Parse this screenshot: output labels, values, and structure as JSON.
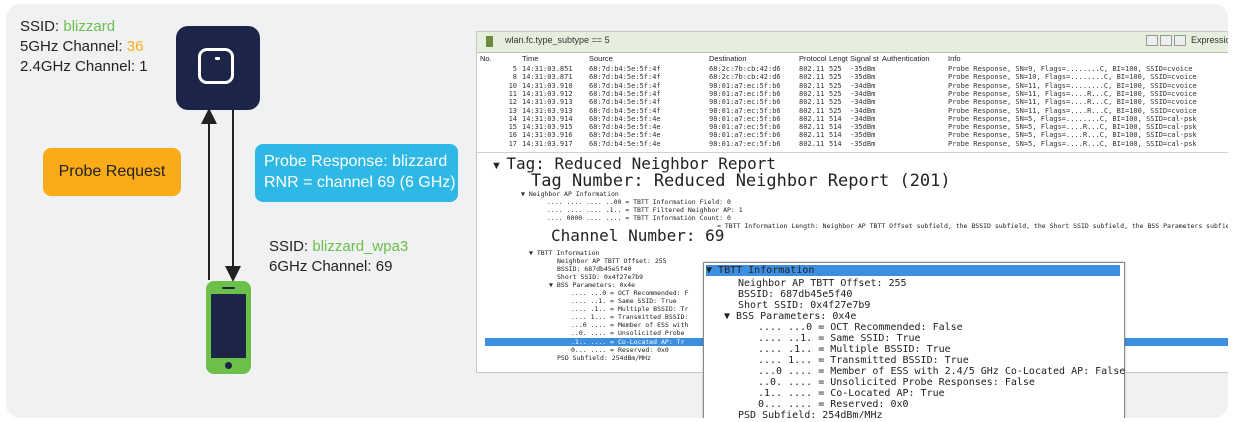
{
  "ap": {
    "ssid_label": "SSID: ",
    "ssid": "blizzard",
    "ch5_label": "5GHz Channel: ",
    "ch5": "36",
    "ch24": "2.4GHz Channel: 1"
  },
  "probe_request": "Probe Request",
  "probe_response": {
    "line1": "Probe Response: blizzard",
    "line2": "RNR = channel 69 (6 GHz)"
  },
  "client": {
    "ssid_label": "SSID: ",
    "ssid": "blizzard_wpa3",
    "channel": "6GHz Channel: 69"
  },
  "colors": {
    "navy": "#1c2447",
    "green": "#6cc04a",
    "orange": "#fbab18",
    "blue": "#2eb8e6"
  },
  "wireshark": {
    "filter": "wlan.fc.type_subtype == 5",
    "expression": "Expression...",
    "columns": [
      "No.",
      "Time",
      "Source",
      "Destination",
      "Protocol",
      "Lengt",
      "Signal st",
      "Authentication",
      "Info"
    ],
    "packets": [
      [
        "5",
        "14:31:03.851",
        "68:7d:b4:5e:5f:4f",
        "68:2c:7b:cb:42:d6",
        "802.11",
        "525",
        "-35dBm",
        "",
        "Probe Response, SN=9, Flags=........C, BI=100, SSID=cvoice"
      ],
      [
        "8",
        "14:31:03.871",
        "68:7d:b4:5e:5f:4f",
        "68:2c:7b:cb:42:d6",
        "802.11",
        "525",
        "-35dBm",
        "",
        "Probe Response, SN=10, Flags=........C, BI=100, SSID=cvoice"
      ],
      [
        "10",
        "14:31:03.910",
        "68:7d:b4:5e:5f:4f",
        "98:01:a7:ec:5f:b6",
        "802.11",
        "525",
        "-34dBm",
        "",
        "Probe Response, SN=11, Flags=........C, BI=100, SSID=cvoice"
      ],
      [
        "11",
        "14:31:03.912",
        "68:7d:b4:5e:5f:4f",
        "98:01:a7:ec:5f:b6",
        "802.11",
        "525",
        "-34dBm",
        "",
        "Probe Response, SN=11, Flags=....R...C, BI=100, SSID=cvoice"
      ],
      [
        "12",
        "14:31:03.913",
        "68:7d:b4:5e:5f:4f",
        "98:01:a7:ec:5f:b6",
        "802.11",
        "525",
        "-34dBm",
        "",
        "Probe Response, SN=11, Flags=....R...C, BI=100, SSID=cvoice"
      ],
      [
        "13",
        "14:31:03.913",
        "68:7d:b4:5e:5f:4f",
        "98:01:a7:ec:5f:b6",
        "802.11",
        "525",
        "-34dBm",
        "",
        "Probe Response, SN=11, Flags=....R...C, BI=100, SSID=cvoice"
      ],
      [
        "14",
        "14:31:03.914",
        "68:7d:b4:5e:5f:4e",
        "98:01:a7:ec:5f:b6",
        "802.11",
        "514",
        "-34dBm",
        "",
        "Probe Response, SN=5, Flags=........C, BI=100, SSID=cal-psk"
      ],
      [
        "15",
        "14:31:03.915",
        "68:7d:b4:5e:5f:4e",
        "98:01:a7:ec:5f:b6",
        "802.11",
        "514",
        "-35dBm",
        "",
        "Probe Response, SN=5, Flags=....R...C, BI=100, SSID=cal-psk"
      ],
      [
        "16",
        "14:31:03.916",
        "68:7d:b4:5e:5f:4e",
        "98:01:a7:ec:5f:b6",
        "802.11",
        "514",
        "-35dBm",
        "",
        "Probe Response, SN=5, Flags=....R...C, BI=100, SSID=cal-psk"
      ],
      [
        "17",
        "14:31:03.917",
        "68:7d:b4:5e:5f:4e",
        "98:01:a7:ec:5f:b6",
        "802.11",
        "514",
        "-35dBm",
        "",
        "Probe Response, SN=5, Flags=....R...C, BI=100, SSID=cal-psk"
      ]
    ],
    "detail": {
      "tag": "Tag: Reduced Neighbor Report",
      "tag_number": "Tag Number: Reduced Neighbor Report (201)",
      "neighbor_ap": "Neighbor AP Information",
      "tbtt_field": ".... .... .... ..00 = TBTT Information Field: 0",
      "filtered": ".... .... .... .1.. = TBTT Filtered Neighbor AP: 1",
      "tbtt_count": ".... 0000 .... .... = TBTT Information Count: 0",
      "tbtt_length_tail": "= TBTT Information Length: Neighbor AP TBTT Offset subfield, the BSSID subfield, the Short SSID subfield, the BSS Parameters subfield an",
      "channel_number": "Channel Number: 69",
      "tbtt_info": "TBTT Information",
      "offset": "Neighbor AP TBTT Offset: 255",
      "bssid": "BSSID: 687db45e5f40",
      "short_ssid": "Short SSID: 0x4f27e7b9",
      "bss_params": "BSS Parameters: 0x4e",
      "p1": ".... ...0 = OCT Recommended: F",
      "p2": ".... ..1. = Same SSID: True",
      "p3": ".... .1.. = Multiple BSSID: Tr",
      "p4": ".... 1... = Transmitted BSSID:",
      "p5": "...0 .... = Member of ESS with",
      "p6": "..0. .... = Unsolicited Probe",
      "p7": ".1.. .... = Co-Located AP: Tr",
      "p8": "0... .... = Reserved: 0x0",
      "psd": "PSD Subfield: 254dBm/MHz"
    },
    "popup": {
      "title": "TBTT Information",
      "offset": "Neighbor AP TBTT Offset: 255",
      "bssid": "BSSID: 687db45e5f40",
      "short_ssid": "Short SSID: 0x4f27e7b9",
      "bss_params": "BSS Parameters: 0x4e",
      "p1": ".... ...0 = OCT Recommended: False",
      "p2": ".... ..1. = Same SSID: True",
      "p3": ".... .1.. = Multiple BSSID: True",
      "p4": ".... 1... = Transmitted BSSID: True",
      "p5": "...0 .... = Member of ESS with 2.4/5 GHz Co-Located AP: False",
      "p6": "..0. .... = Unsolicited Probe Responses: False",
      "p7": ".1.. .... = Co-Located AP: True",
      "p8": "0... .... = Reserved: 0x0",
      "psd": "PSD Subfield: 254dBm/MHz"
    }
  }
}
